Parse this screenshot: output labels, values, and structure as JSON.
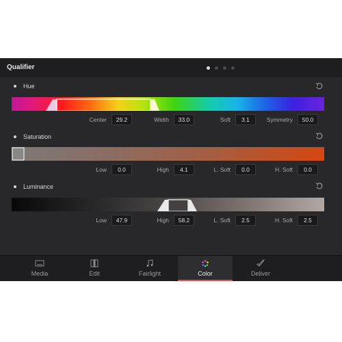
{
  "panel": {
    "title": "Qualifier",
    "page_dots": 4,
    "active_dot": 0
  },
  "hue": {
    "label": "Hue",
    "fields": [
      {
        "label": "Center",
        "value": "29.2"
      },
      {
        "label": "Width",
        "value": "33.0"
      },
      {
        "label": "Soft",
        "value": "3.1"
      },
      {
        "label": "Symmetry",
        "value": "50.0"
      }
    ]
  },
  "saturation": {
    "label": "Saturation",
    "fields": [
      {
        "label": "Low",
        "value": "0.0"
      },
      {
        "label": "High",
        "value": "4.1"
      },
      {
        "label": "L. Soft",
        "value": "0.0"
      },
      {
        "label": "H. Soft",
        "value": "0.0"
      }
    ]
  },
  "luminance": {
    "label": "Luminance",
    "fields": [
      {
        "label": "Low",
        "value": "47.9"
      },
      {
        "label": "High",
        "value": "58.2"
      },
      {
        "label": "L. Soft",
        "value": "2.5"
      },
      {
        "label": "H. Soft",
        "value": "2.5"
      }
    ]
  },
  "tabs": [
    {
      "label": "Media",
      "icon": "media-icon",
      "active": false
    },
    {
      "label": "Edit",
      "icon": "edit-icon",
      "active": false
    },
    {
      "label": "Fairlight",
      "icon": "music-note-icon",
      "active": false
    },
    {
      "label": "Color",
      "icon": "color-wheel-icon",
      "active": true
    },
    {
      "label": "Deliver",
      "icon": "rocket-icon",
      "active": false
    }
  ],
  "colors": {
    "accent": "#e0555b",
    "panel_bg": "#28282b",
    "titlebar_bg": "#1e1e21"
  }
}
